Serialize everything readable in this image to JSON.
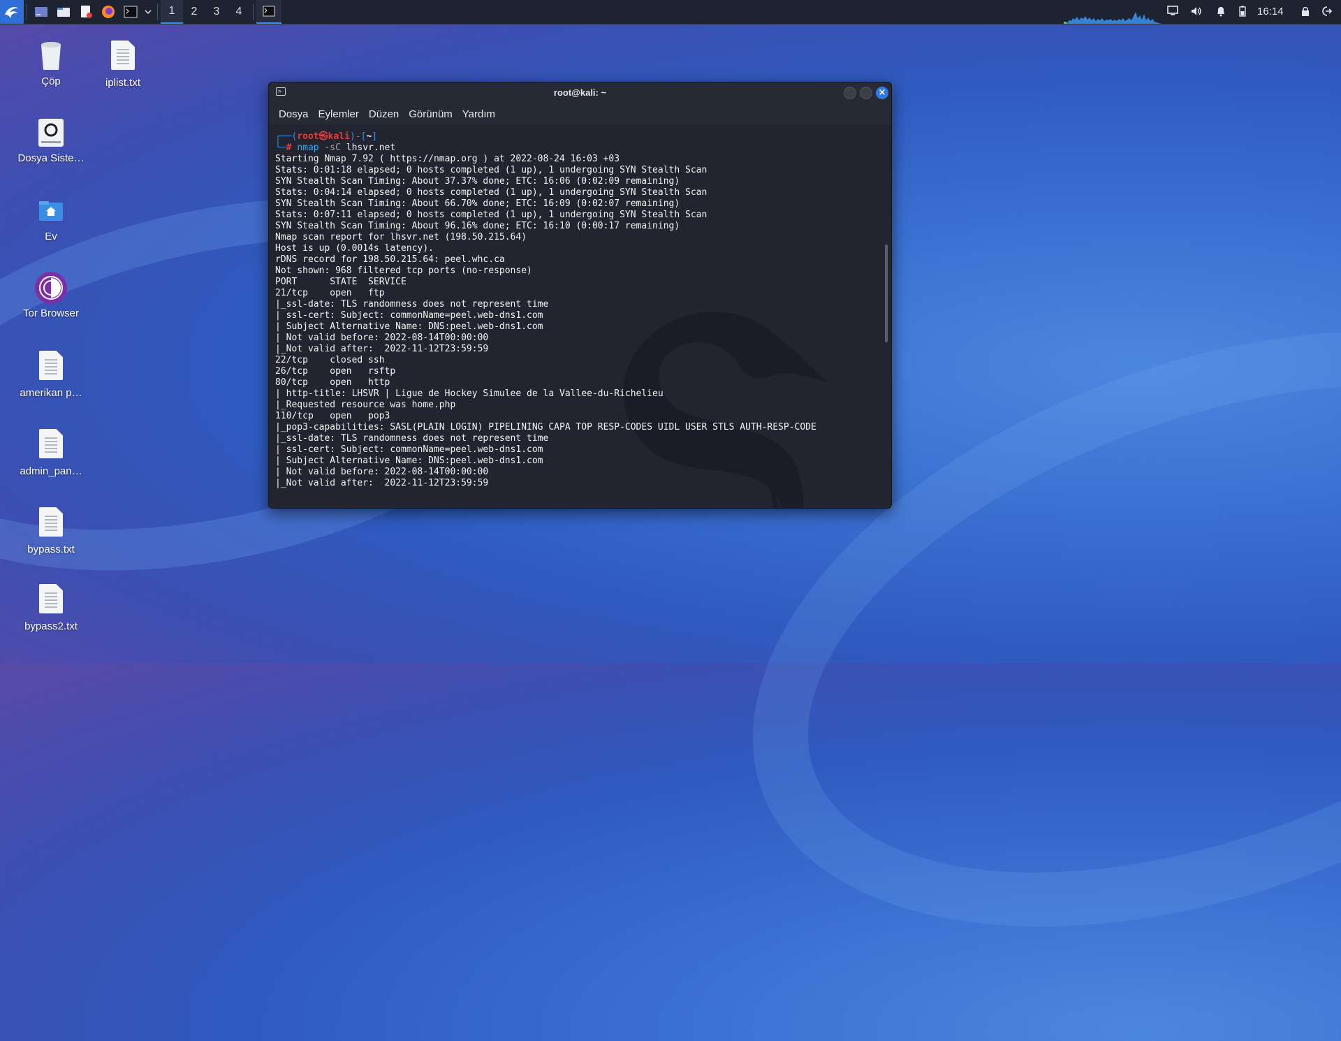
{
  "panel": {
    "workspaces": [
      "1",
      "2",
      "3",
      "4"
    ],
    "clock": "16:14",
    "accent": "#3a8ee6"
  },
  "desktop": {
    "icons": [
      {
        "label": "Çöp",
        "icon": "trash-icon"
      },
      {
        "label": "iplist.txt",
        "icon": "text-file-icon"
      },
      {
        "label": "Dosya Siste…",
        "icon": "drive-icon"
      },
      {
        "label": "Ev",
        "icon": "home-folder-icon"
      },
      {
        "label": "Tor Browser",
        "icon": "tor-browser-icon"
      },
      {
        "label": "amerikan p…",
        "icon": "text-file-icon"
      },
      {
        "label": "admin_pan…",
        "icon": "text-file-icon"
      },
      {
        "label": "bypass.txt",
        "icon": "text-file-icon"
      },
      {
        "label": "bypass2.txt",
        "icon": "text-file-icon"
      }
    ]
  },
  "terminal": {
    "title": "root@kali: ~",
    "menu": [
      "Dosya",
      "Eylemler",
      "Düzen",
      "Görünüm",
      "Yardım"
    ],
    "prompt": {
      "user": "root",
      "at": "㉿",
      "host": "kali",
      "dir": "~",
      "cmd": "nmap",
      "flag": "-sC",
      "target": "lhsvr.net"
    },
    "output": [
      "Starting Nmap 7.92 ( https://nmap.org ) at 2022-08-24 16:03 +03",
      "Stats: 0:01:18 elapsed; 0 hosts completed (1 up), 1 undergoing SYN Stealth Scan",
      "SYN Stealth Scan Timing: About 37.37% done; ETC: 16:06 (0:02:09 remaining)",
      "Stats: 0:04:14 elapsed; 0 hosts completed (1 up), 1 undergoing SYN Stealth Scan",
      "SYN Stealth Scan Timing: About 66.70% done; ETC: 16:09 (0:02:07 remaining)",
      "Stats: 0:07:11 elapsed; 0 hosts completed (1 up), 1 undergoing SYN Stealth Scan",
      "SYN Stealth Scan Timing: About 96.16% done; ETC: 16:10 (0:00:17 remaining)",
      "Nmap scan report for lhsvr.net (198.50.215.64)",
      "Host is up (0.0014s latency).",
      "rDNS record for 198.50.215.64: peel.whc.ca",
      "Not shown: 968 filtered tcp ports (no-response)",
      "PORT      STATE  SERVICE",
      "21/tcp    open   ftp",
      "|_ssl-date: TLS randomness does not represent time",
      "| ssl-cert: Subject: commonName=peel.web-dns1.com",
      "| Subject Alternative Name: DNS:peel.web-dns1.com",
      "| Not valid before: 2022-08-14T00:00:00",
      "|_Not valid after:  2022-11-12T23:59:59",
      "22/tcp    closed ssh",
      "26/tcp    open   rsftp",
      "80/tcp    open   http",
      "| http-title: LHSVR | Ligue de Hockey Simulee de la Vallee-du-Richelieu",
      "|_Requested resource was home.php",
      "110/tcp   open   pop3",
      "|_pop3-capabilities: SASL(PLAIN LOGIN) PIPELINING CAPA TOP RESP-CODES UIDL USER STLS AUTH-RESP-CODE",
      "|_ssl-date: TLS randomness does not represent time",
      "| ssl-cert: Subject: commonName=peel.web-dns1.com",
      "| Subject Alternative Name: DNS:peel.web-dns1.com",
      "| Not valid before: 2022-08-14T00:00:00",
      "|_Not valid after:  2022-11-12T23:59:59"
    ]
  }
}
